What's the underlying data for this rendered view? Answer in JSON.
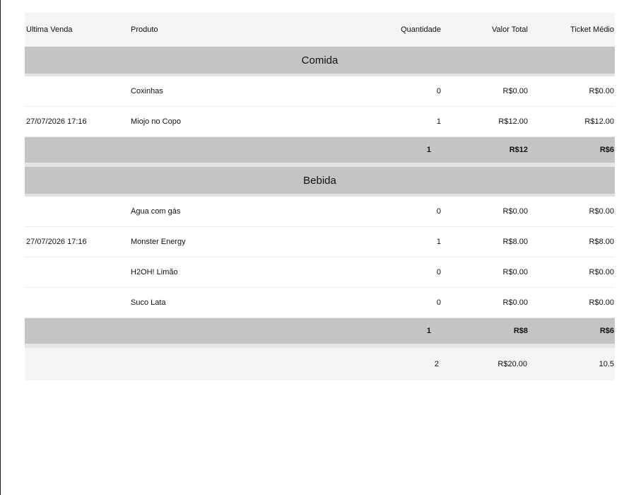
{
  "table": {
    "headers": {
      "last_sale": "Última Venda",
      "product": "Produto",
      "quantity": "Quantidade",
      "total_value": "Valor Total",
      "avg_ticket": "Ticket Médio"
    },
    "groups": [
      {
        "name": "Comida",
        "rows": [
          {
            "last_sale": "",
            "product": "Coxinhas",
            "quantity": "0",
            "total_value": "R$0.00",
            "avg_ticket": "R$0.00"
          },
          {
            "last_sale": "27/07/2026 17:16",
            "product": "Miojo no Copo",
            "quantity": "1",
            "total_value": "R$12.00",
            "avg_ticket": "R$12.00"
          }
        ],
        "subtotal": {
          "quantity": "1",
          "total_value": "R$12",
          "avg_ticket": "R$6"
        }
      },
      {
        "name": "Bebida",
        "rows": [
          {
            "last_sale": "",
            "product": "Água com gás",
            "quantity": "0",
            "total_value": "R$0.00",
            "avg_ticket": "R$0.00"
          },
          {
            "last_sale": "27/07/2026 17:16",
            "product": "Monster Energy",
            "quantity": "1",
            "total_value": "R$8.00",
            "avg_ticket": "R$8.00"
          },
          {
            "last_sale": "",
            "product": "H2OH! Limão",
            "quantity": "0",
            "total_value": "R$0.00",
            "avg_ticket": "R$0.00"
          },
          {
            "last_sale": "",
            "product": "Suco Lata",
            "quantity": "0",
            "total_value": "R$0.00",
            "avg_ticket": "R$0.00"
          }
        ],
        "subtotal": {
          "quantity": "1",
          "total_value": "R$8",
          "avg_ticket": "R$6"
        }
      }
    ],
    "grand_total": {
      "quantity": "2",
      "total_value": "R$20.00",
      "avg_ticket": "10.5"
    }
  }
}
